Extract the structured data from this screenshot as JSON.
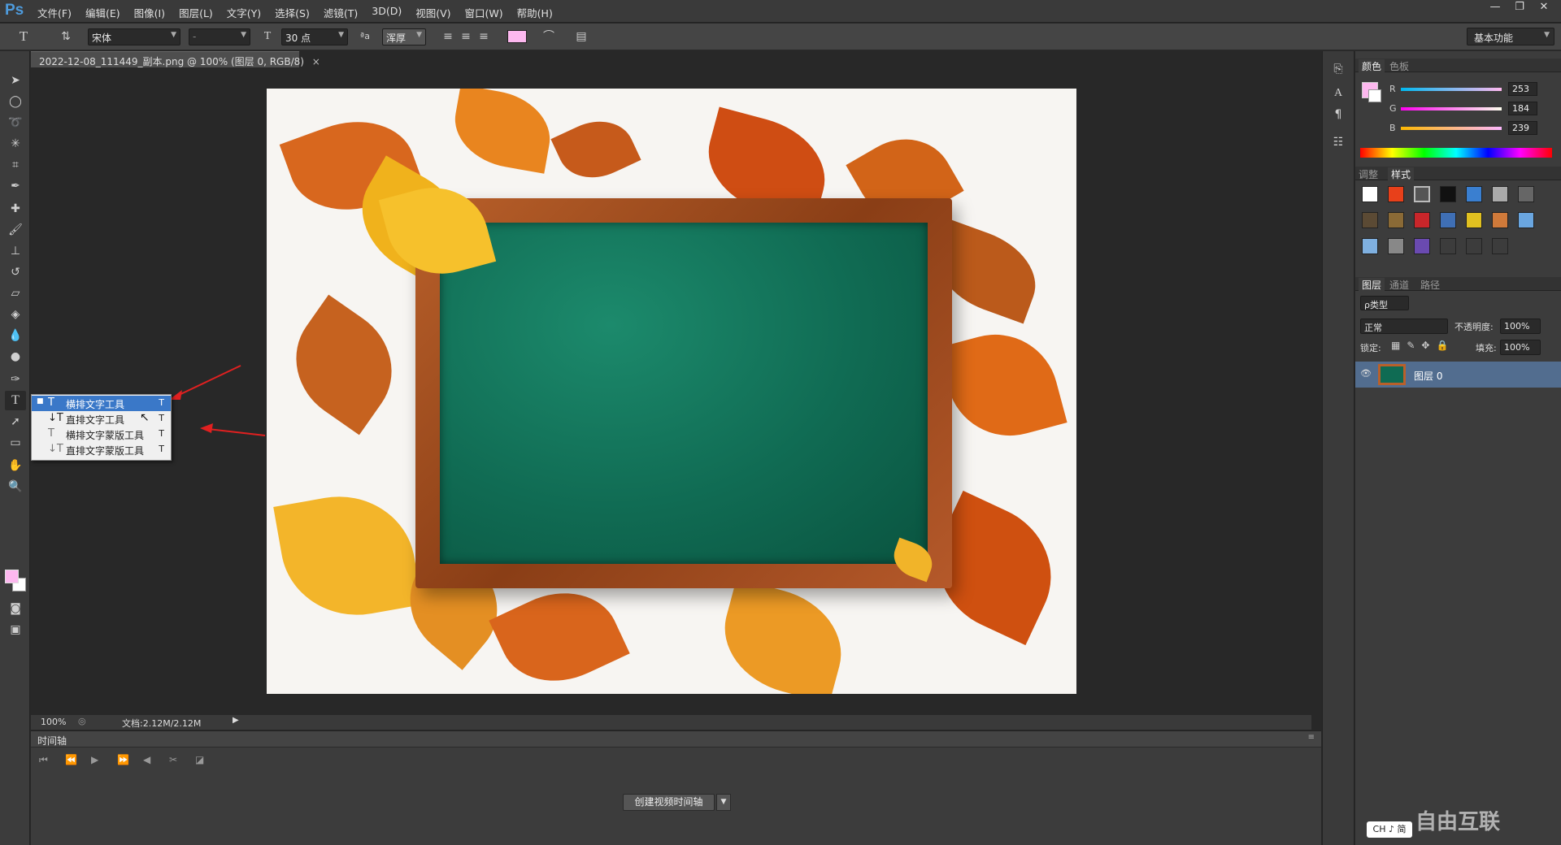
{
  "app": {
    "logo": "Ps"
  },
  "menubar": {
    "items": [
      "文件(F)",
      "编辑(E)",
      "图像(I)",
      "图层(L)",
      "文字(Y)",
      "选择(S)",
      "滤镜(T)",
      "3D(D)",
      "视图(V)",
      "窗口(W)",
      "帮助(H)"
    ]
  },
  "window_controls": {
    "minimize": "—",
    "restore": "❐",
    "close": "✕"
  },
  "options_bar": {
    "font_family": "宋体",
    "font_style": "-",
    "font_size": "30 点",
    "antialias": "浑厚",
    "aa_label": "ªa",
    "text_color": "#fdb8ef",
    "workspace": "基本功能"
  },
  "document": {
    "tab_title": "2022-12-08_111449_副本.png @ 100% (图层 0, RGB/8)",
    "close": "×"
  },
  "tool_flyout": {
    "items": [
      {
        "label": "横排文字工具",
        "key": "T",
        "selected": true
      },
      {
        "label": "直排文字工具",
        "key": "T",
        "selected": false
      },
      {
        "label": "横排文字蒙版工具",
        "key": "T",
        "selected": false
      },
      {
        "label": "直排文字蒙版工具",
        "key": "T",
        "selected": false
      }
    ]
  },
  "status": {
    "zoom": "100%",
    "doc_size": "文档:2.12M/2.12M"
  },
  "timeline": {
    "title": "时间轴",
    "create_button": "创建视频时间轴"
  },
  "color_panel": {
    "tabs": [
      "颜色",
      "色板"
    ],
    "channels": [
      {
        "label": "R",
        "value": "253"
      },
      {
        "label": "G",
        "value": "184"
      },
      {
        "label": "B",
        "value": "239"
      }
    ],
    "foreground": "#fdb8ef"
  },
  "styles_panel": {
    "tabs": [
      "调整",
      "样式"
    ]
  },
  "layers_panel": {
    "tabs": [
      "图层",
      "通道",
      "路径"
    ],
    "filter": "ρ类型",
    "blend_mode": "正常",
    "opacity_label": "不透明度:",
    "opacity": "100%",
    "lock_label": "锁定:",
    "fill_label": "填充:",
    "fill": "100%",
    "layers": [
      {
        "name": "图层 0",
        "visible": true
      }
    ],
    "eye": "👁"
  },
  "ime": {
    "label": "CH ♪ 简"
  },
  "watermark": {
    "text": "自由互联"
  }
}
